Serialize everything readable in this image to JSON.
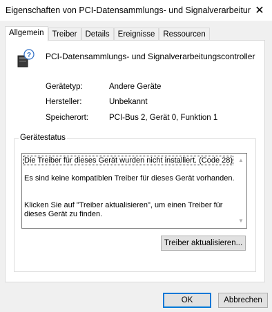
{
  "window": {
    "title": "Eigenschaften von PCI-Datensammlungs- und Signalverarbeitung...",
    "close_glyph": "✕"
  },
  "tabs": [
    {
      "label": "Allgemein",
      "active": true
    },
    {
      "label": "Treiber",
      "active": false
    },
    {
      "label": "Details",
      "active": false
    },
    {
      "label": "Ereignisse",
      "active": false
    },
    {
      "label": "Ressourcen",
      "active": false
    }
  ],
  "device": {
    "icon": "unknown-device-icon",
    "name": "PCI-Datensammlungs- und Signalverarbeitungscontroller"
  },
  "properties": [
    {
      "label": "Gerätetyp:",
      "value": "Andere Geräte"
    },
    {
      "label": "Hersteller:",
      "value": "Unbekannt"
    },
    {
      "label": "Speicherort:",
      "value": "PCI-Bus 2, Gerät 0, Funktion 1"
    }
  ],
  "status": {
    "legend": "Gerätestatus",
    "lines": [
      "Die Treiber für dieses Gerät wurden nicht installiert. (Code 28)",
      "Es sind keine kompatiblen Treiber für dieses Gerät vorhanden.",
      "Klicken Sie auf \"Treiber aktualisieren\", um einen Treiber für dieses Gerät zu finden."
    ],
    "update_button": "Treiber aktualisieren..."
  },
  "buttons": {
    "ok": "OK",
    "cancel": "Abbrechen"
  }
}
